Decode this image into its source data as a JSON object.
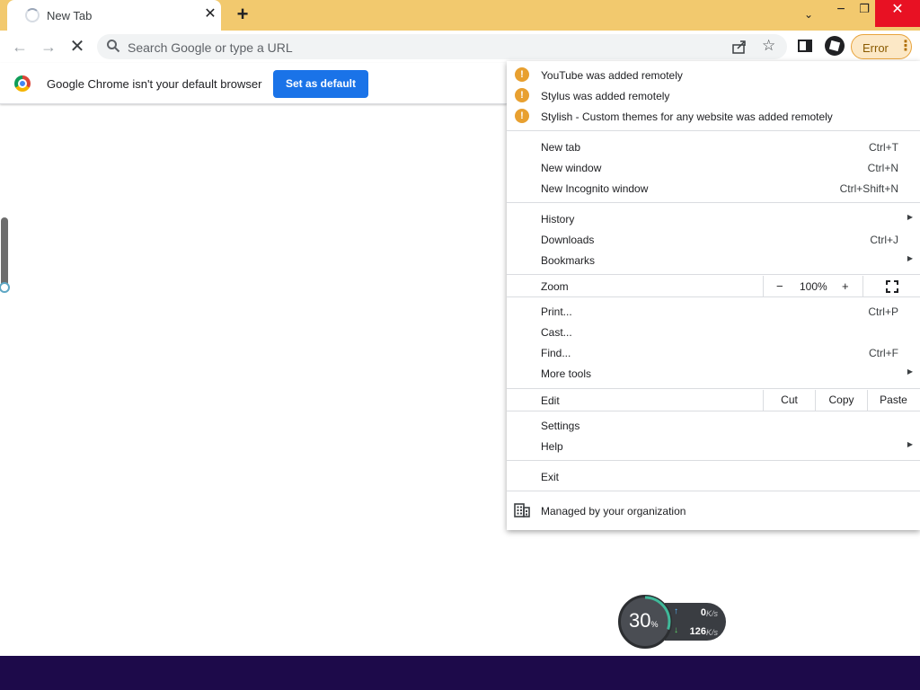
{
  "tab": {
    "title": "New Tab",
    "close": "✕"
  },
  "titlebar": {
    "new_tab": "+",
    "tab_search": "⌄",
    "minimize": "−",
    "restore": "❐",
    "close": "✕"
  },
  "toolbar": {
    "back": "←",
    "forward": "→",
    "stop": "✕",
    "omnibox_placeholder": "Search Google or type a URL",
    "bookmark_star": "☆",
    "error_label": "Error",
    "menu_dots": "⋮"
  },
  "infobar": {
    "message": "Google Chrome isn't your default browser",
    "button": "Set as default"
  },
  "menu": {
    "notifications": [
      "YouTube was added remotely",
      "Stylus was added remotely",
      "Stylish - Custom themes for any website was added remotely"
    ],
    "new_tab": {
      "label": "New tab",
      "shortcut": "Ctrl+T"
    },
    "new_window": {
      "label": "New window",
      "shortcut": "Ctrl+N"
    },
    "new_incognito": {
      "label": "New Incognito window",
      "shortcut": "Ctrl+Shift+N"
    },
    "history": {
      "label": "History"
    },
    "downloads": {
      "label": "Downloads",
      "shortcut": "Ctrl+J"
    },
    "bookmarks": {
      "label": "Bookmarks"
    },
    "zoom": {
      "label": "Zoom",
      "minus": "−",
      "value": "100%",
      "plus": "+"
    },
    "print": {
      "label": "Print...",
      "shortcut": "Ctrl+P"
    },
    "cast": {
      "label": "Cast..."
    },
    "find": {
      "label": "Find...",
      "shortcut": "Ctrl+F"
    },
    "more_tools": {
      "label": "More tools"
    },
    "edit": {
      "label": "Edit",
      "cut": "Cut",
      "copy": "Copy",
      "paste": "Paste"
    },
    "settings": {
      "label": "Settings"
    },
    "help": {
      "label": "Help"
    },
    "exit": {
      "label": "Exit"
    },
    "managed": {
      "label": "Managed by your organization"
    },
    "submenu_arrow": "▶",
    "warning_glyph": "!"
  },
  "net_widget": {
    "percent": "30",
    "percent_sign": "%",
    "upload": "0",
    "download": "126",
    "unit": "K/s",
    "up_arrow": "↑",
    "down_arrow": "↓"
  },
  "colors": {
    "titlebar": "#f2c96e",
    "primary_button": "#1a73e8",
    "warning": "#e8a030",
    "close_button": "#e81123",
    "taskbar": "#1d0a4a"
  },
  "icons": {
    "tab": "loading-spinner-icon",
    "search": "search-icon",
    "share": "share-icon",
    "star": "star-icon",
    "side_panel": "side-panel-icon",
    "extension": "roblox-icon",
    "fullscreen": "fullscreen-icon",
    "managed": "building-icon",
    "warning": "warning-icon"
  }
}
